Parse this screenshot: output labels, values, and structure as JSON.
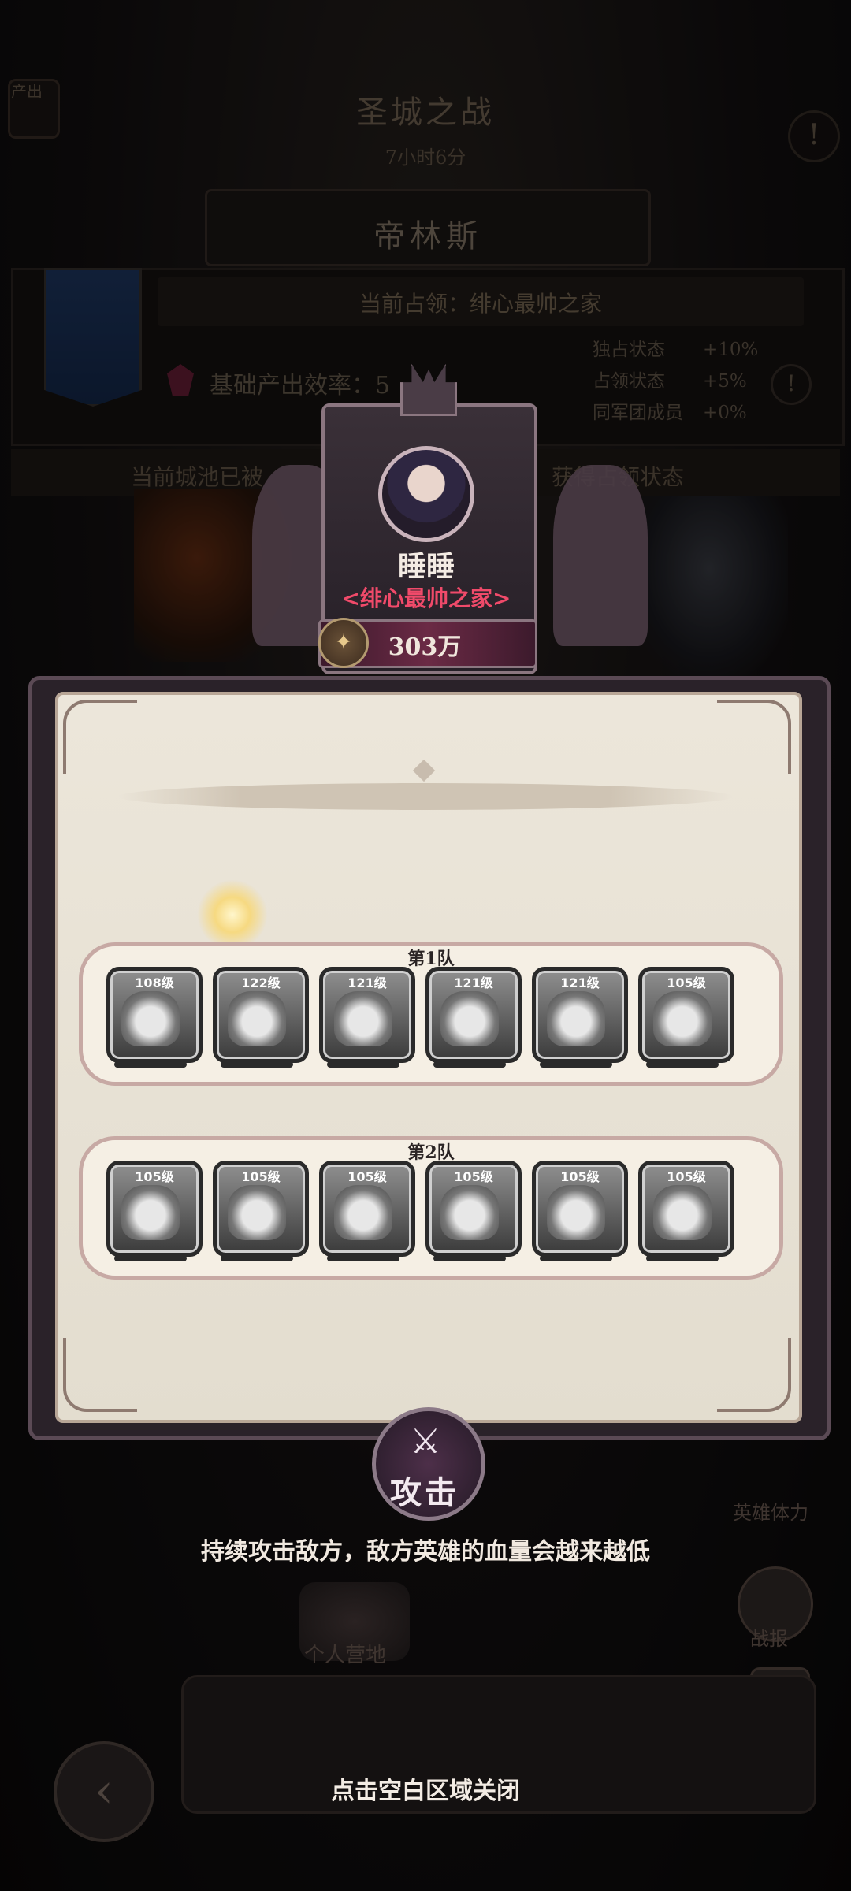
{
  "event": {
    "title": "圣城之战",
    "timer": "7小时6分",
    "top_left_label": "产出",
    "info_icon": "!"
  },
  "city": {
    "name": "帝林斯",
    "occupy_label": "当前占领：绯心最帅之家",
    "base_output_label": "基础产出效率：5",
    "stats": [
      {
        "label": "独占状态",
        "value": "+10%"
      },
      {
        "label": "占领状态",
        "value": "+5%"
      },
      {
        "label": "同军团成员",
        "value": "+0%"
      }
    ],
    "notice_left": "当前城池已被",
    "notice_right": "获得占领状态"
  },
  "player": {
    "name": "睡睡",
    "guild": "<绯心最帅之家>",
    "power": "303万"
  },
  "teams": [
    {
      "title": "第1队",
      "heroes": [
        {
          "level": "108级"
        },
        {
          "level": "122级"
        },
        {
          "level": "121级"
        },
        {
          "level": "121级"
        },
        {
          "level": "121级"
        },
        {
          "level": "105级"
        }
      ]
    },
    {
      "title": "第2队",
      "heroes": [
        {
          "level": "105级"
        },
        {
          "level": "105级"
        },
        {
          "level": "105级"
        },
        {
          "level": "105级"
        },
        {
          "level": "105级"
        },
        {
          "level": "105级"
        }
      ]
    }
  ],
  "attack": {
    "label": "攻击",
    "hint": "持续攻击敌方，敌方英雄的血量会越来越低"
  },
  "close_hint": "点击空白区域关闭",
  "side": {
    "top_right_label": "英雄体力",
    "battle_report": "战报",
    "bottom_label": "个人营地"
  },
  "colors": {
    "guild_name": "#f04a6a",
    "dialog_bg": "#ece6da",
    "team_border": "#c7a9a4"
  }
}
